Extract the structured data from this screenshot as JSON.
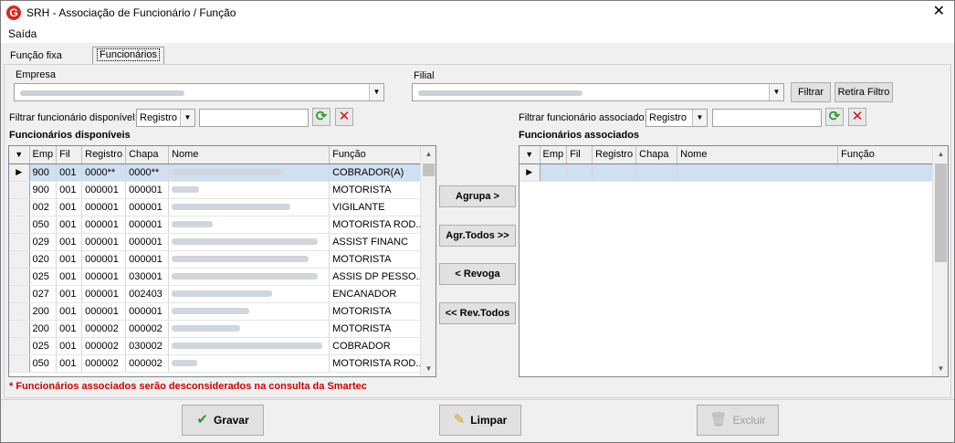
{
  "window": {
    "title": "SRH - Associação de Funcionário / Função",
    "close": "✕",
    "app_icon": "G"
  },
  "menu": {
    "items": [
      {
        "label": "Saída"
      }
    ]
  },
  "tabs": [
    {
      "label": "Função fixa"
    },
    {
      "label": "Funcionários"
    }
  ],
  "filters": {
    "empresa_label": "Empresa",
    "filial_label": "Filial",
    "filtrar_label": "Filtrar",
    "retira_label": "Retira Filtro"
  },
  "left": {
    "filter_label": "Filtrar funcionário disponível:",
    "filter_combo": "Registro",
    "section_title": "Funcionários disponíveis",
    "columns": [
      "Emp",
      "Fil",
      "Registro",
      "Chapa",
      "Nome",
      "Função"
    ],
    "rows": [
      {
        "emp": "900",
        "fil": "001",
        "registro": "0000**",
        "chapa": "0000**",
        "funcao": "COBRADOR(A)"
      },
      {
        "emp": "900",
        "fil": "001",
        "registro": "000001",
        "chapa": "000001",
        "funcao": "MOTORISTA"
      },
      {
        "emp": "002",
        "fil": "001",
        "registro": "000001",
        "chapa": "000001",
        "funcao": "VIGILANTE"
      },
      {
        "emp": "050",
        "fil": "001",
        "registro": "000001",
        "chapa": "000001",
        "funcao": "MOTORISTA ROD..."
      },
      {
        "emp": "029",
        "fil": "001",
        "registro": "000001",
        "chapa": "000001",
        "funcao": "ASSIST FINANC"
      },
      {
        "emp": "020",
        "fil": "001",
        "registro": "000001",
        "chapa": "000001",
        "funcao": "MOTORISTA"
      },
      {
        "emp": "025",
        "fil": "001",
        "registro": "000001",
        "chapa": "030001",
        "funcao": "ASSIS DP PESSO..."
      },
      {
        "emp": "027",
        "fil": "001",
        "registro": "000001",
        "chapa": "002403",
        "funcao": "ENCANADOR"
      },
      {
        "emp": "200",
        "fil": "001",
        "registro": "000001",
        "chapa": "000001",
        "funcao": "MOTORISTA"
      },
      {
        "emp": "200",
        "fil": "001",
        "registro": "000002",
        "chapa": "000002",
        "funcao": "MOTORISTA"
      },
      {
        "emp": "025",
        "fil": "001",
        "registro": "000002",
        "chapa": "030002",
        "funcao": "COBRADOR"
      },
      {
        "emp": "050",
        "fil": "001",
        "registro": "000002",
        "chapa": "000002",
        "funcao": "MOTORISTA ROD..."
      }
    ]
  },
  "middle": {
    "agrupa": "Agrupa >",
    "agr_todos": "Agr.Todos >>",
    "revoga": "< Revoga",
    "rev_todos": "<< Rev.Todos"
  },
  "right": {
    "filter_label": "Filtrar funcionário associado:",
    "filter_combo": "Registro",
    "section_title": "Funcionários associados",
    "columns": [
      "Emp",
      "Fil",
      "Registro",
      "Chapa",
      "Nome",
      "Função"
    ]
  },
  "warning": "* Funcionários associados serão desconsiderados na consulta da Smartec",
  "footer": {
    "gravar": "Gravar",
    "limpar": "Limpar",
    "excluir": "Excluir"
  },
  "colors": {
    "warning": "#d00000",
    "selection": "#cfe0f2",
    "refresh": "#2a9a2a",
    "delete": "#d01010"
  }
}
